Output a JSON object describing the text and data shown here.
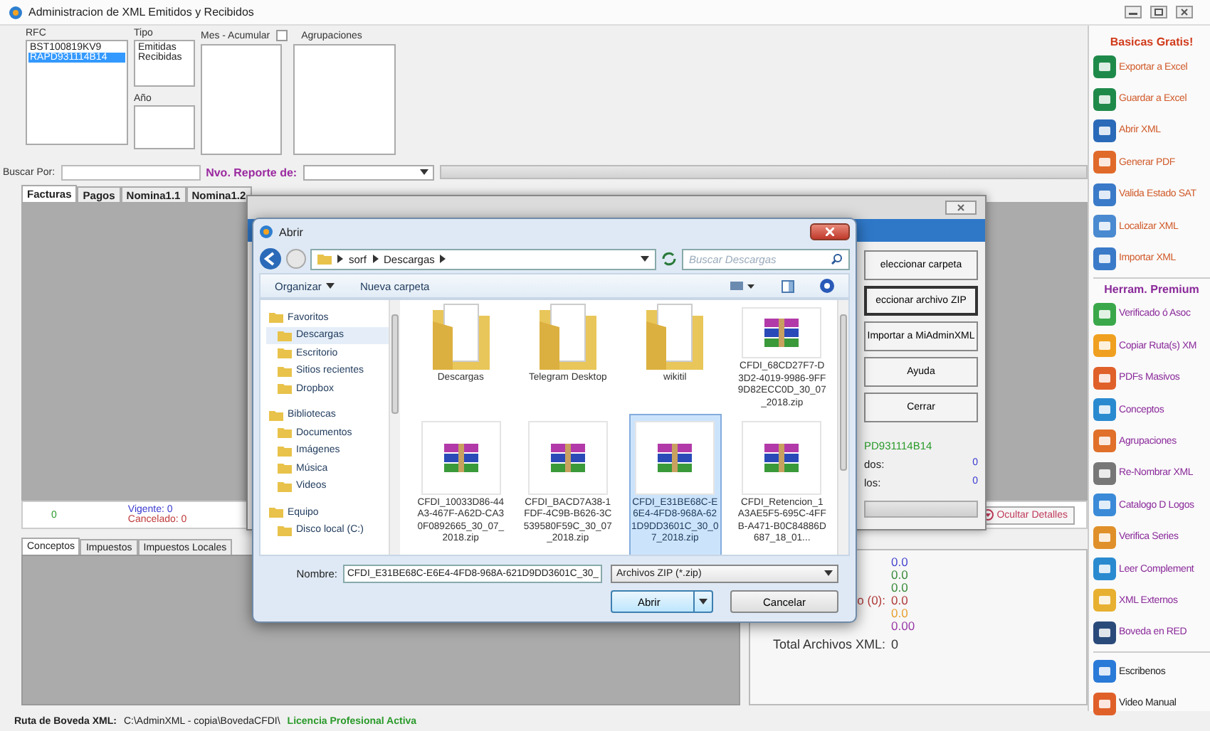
{
  "window": {
    "title": "Administracion de XML  Emitidos y Recibidos"
  },
  "filters": {
    "rfc": {
      "label": "RFC",
      "items": [
        {
          "text": "BST100819KV9",
          "selected": false
        },
        {
          "text": "RAPD931114B14",
          "selected": true
        }
      ]
    },
    "tipo": {
      "label": "Tipo",
      "items": [
        "Emitidas",
        "Recibidas"
      ]
    },
    "anio": {
      "label": "Año"
    },
    "mes": {
      "label": "Mes - Acumular",
      "checked": false
    },
    "agrupaciones": {
      "label": "Agrupaciones"
    }
  },
  "search": {
    "label": "Buscar Por:",
    "report_label": "Nvo. Reporte de:",
    "progress": {
      "level": 0
    }
  },
  "tabs": [
    {
      "label": "Facturas",
      "selected": true
    },
    {
      "label": "Pagos",
      "selected": false
    },
    {
      "label": "Nomina1.1",
      "selected": false
    },
    {
      "label": "Nomina1.2",
      "selected": false
    }
  ],
  "summary": {
    "count": "0",
    "vigente": "Vigente: 0",
    "cancelado": "Cancelado: 0",
    "hide_button": "Ocultar Detalles"
  },
  "detail_tabs": [
    {
      "label": "Conceptos",
      "selected": true
    },
    {
      "label": "Impuestos",
      "selected": false
    },
    {
      "label": "Impuestos Locales",
      "selected": false
    }
  ],
  "totals": [
    {
      "value": "0.0",
      "color": "#4a4ad0"
    },
    {
      "value": "0.0",
      "color": "#3a8a3a"
    },
    {
      "value": "0.0",
      "color": "#3a8a3a"
    },
    {
      "label": "o (0):",
      "value": "0.0",
      "color": "#b03a3a"
    },
    {
      "value": "0.0",
      "color": "#e8a030"
    },
    {
      "value": "0.00",
      "color": "#9a3aa8"
    },
    {
      "label": "Total Archivos XML:",
      "value": "0",
      "color": "#333333"
    }
  ],
  "status_bar": {
    "label": "Ruta de Boveda XML:",
    "path": "C:\\AdminXML - copia\\BovedaCFDI\\",
    "license": "Licencia Profesional Activa"
  },
  "sidebar": [
    {
      "title": "Basicas Gratis!",
      "kind": "basic",
      "items": [
        "Exportar a Excel",
        "Guardar a Excel",
        "Abrir XML",
        "Generar PDF",
        "Valida Estado SAT",
        "Localizar XML",
        "Importar XML"
      ]
    },
    {
      "title": "Herram. Premium",
      "kind": "premium",
      "items": [
        "Verificado ó Asoc",
        "Copiar Ruta(s) XM",
        "PDFs Masivos",
        "Conceptos",
        "Agrupaciones",
        "Re-Nombrar XML",
        "Catalogo D Logos",
        "Verifica Series",
        "Leer Complement",
        "XML Externos",
        "Boveda en RED"
      ]
    },
    {
      "kind": "contact",
      "items": [
        "Escribenos",
        "Video Manual"
      ]
    }
  ],
  "importer": {
    "buttons": [
      {
        "label": "eleccionar carpeta",
        "focused": false
      },
      {
        "label": "eccionar archivo ZIP",
        "focused": true
      },
      {
        "label": "Importar a MiAdminXML",
        "focused": false
      },
      {
        "label": "Ayuda",
        "focused": false
      },
      {
        "label": "Cerrar",
        "focused": false
      }
    ],
    "rfc": "PD931114B14",
    "counts": [
      {
        "label": "dos:",
        "value": "0"
      },
      {
        "label": "los:",
        "value": "0"
      }
    ],
    "progress": {
      "level": 0
    }
  },
  "open_dialog": {
    "title": "Abrir",
    "path": [
      "sorf",
      "Descargas"
    ],
    "search_placeholder": "Buscar Descargas",
    "toolbar": [
      "Organizar",
      "Nueva carpeta"
    ],
    "nav": [
      {
        "label": "Favoritos",
        "selected": false,
        "children": [
          {
            "label": "Descargas",
            "selected": true
          },
          {
            "label": "Escritorio",
            "selected": false
          },
          {
            "label": "Sitios recientes",
            "selected": false
          },
          {
            "label": "Dropbox",
            "selected": false
          }
        ]
      },
      {
        "label": "Bibliotecas",
        "selected": false,
        "children": [
          {
            "label": "Documentos",
            "selected": false
          },
          {
            "label": "Imágenes",
            "selected": false
          },
          {
            "label": "Música",
            "selected": false
          },
          {
            "label": "Videos",
            "selected": false
          }
        ]
      },
      {
        "label": "Equipo",
        "selected": false,
        "children": [
          {
            "label": "Disco local (C:)",
            "selected": false
          }
        ]
      }
    ],
    "files": [
      {
        "name": "Descargas",
        "kind": "folder",
        "selected": false
      },
      {
        "name": "Telegram Desktop",
        "kind": "folder",
        "selected": false
      },
      {
        "name": "wikitil",
        "kind": "folder",
        "selected": false
      },
      {
        "name": "CFDI_68CD27F7-D3D2-4019-9986-9FF9D82ECC0D_30_07_2018.zip",
        "kind": "zip",
        "selected": false
      },
      {
        "name": "CFDI_10033D86-44A3-467F-A62D-CA30F0892665_30_07_2018.zip",
        "kind": "zip",
        "selected": false
      },
      {
        "name": "CFDI_BACD7A38-1FDF-4C9B-B626-3C539580F59C_30_07_2018.zip",
        "kind": "zip",
        "selected": false
      },
      {
        "name": "CFDI_E31BE68C-E6E4-4FD8-968A-621D9DD3601C_30_07_2018.zip",
        "kind": "zip",
        "selected": true
      },
      {
        "name": "CFDI_Retencion_1A3AE5F5-695C-4FFB-A471-B0C84886D687_18_01...",
        "kind": "zip",
        "selected": false
      }
    ],
    "filename_label": "Nombre:",
    "filename": "CFDI_E31BE68C-E6E4-4FD8-968A-621D9DD3601C_30_",
    "file_type": "Archivos ZIP (*.zip)",
    "open_button": "Abrir",
    "cancel_button": "Cancelar"
  }
}
